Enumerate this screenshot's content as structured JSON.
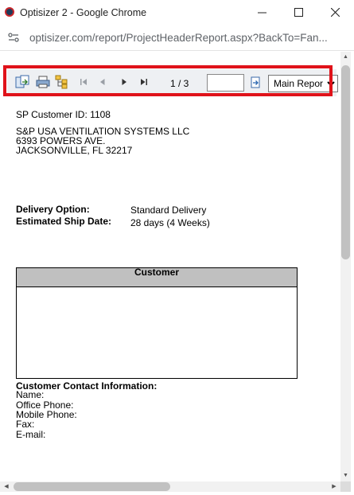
{
  "window": {
    "title": "Optisizer 2 - Google Chrome",
    "minimize_glyph": "—",
    "maximize_glyph": "☐",
    "close_glyph": "✕"
  },
  "address_bar": {
    "url": "optisizer.com/report/ProjectHeaderReport.aspx?BackTo=Fan..."
  },
  "toolbar": {
    "page_indicator": "1 / 3",
    "page_input_value": "",
    "report_select_value": "Main Report",
    "report_select_options": [
      "Main Report"
    ],
    "icons": [
      "export-icon",
      "print-icon",
      "document-map-icon",
      "first-page-icon",
      "previous-page-icon",
      "next-page-icon",
      "last-page-icon",
      "go-to-page-icon"
    ]
  },
  "report": {
    "customer_id_label": "SP Customer ID:",
    "customer_id_value": "1108",
    "company_name": "S&P USA VENTILATION SYSTEMS LLC",
    "address_line1": "6393 POWERS AVE.",
    "address_line2": "JACKSONVILLE, FL 32217",
    "delivery_option_label": "Delivery Option:",
    "delivery_option_value": "Standard Delivery",
    "ship_date_label": "Estimated Ship Date:",
    "ship_date_value": "28 days (4 Weeks)",
    "customer_box_title": "Customer",
    "contact_heading": "Customer Contact Information:",
    "contact_fields": [
      "Name:",
      "Office Phone:",
      "Mobile Phone:",
      "Fax:",
      "E-mail:"
    ]
  },
  "colors": {
    "highlight_border": "#e0121a",
    "toolbar_bg": "#eef0f3",
    "customer_header_bg": "#c0c0c0"
  }
}
